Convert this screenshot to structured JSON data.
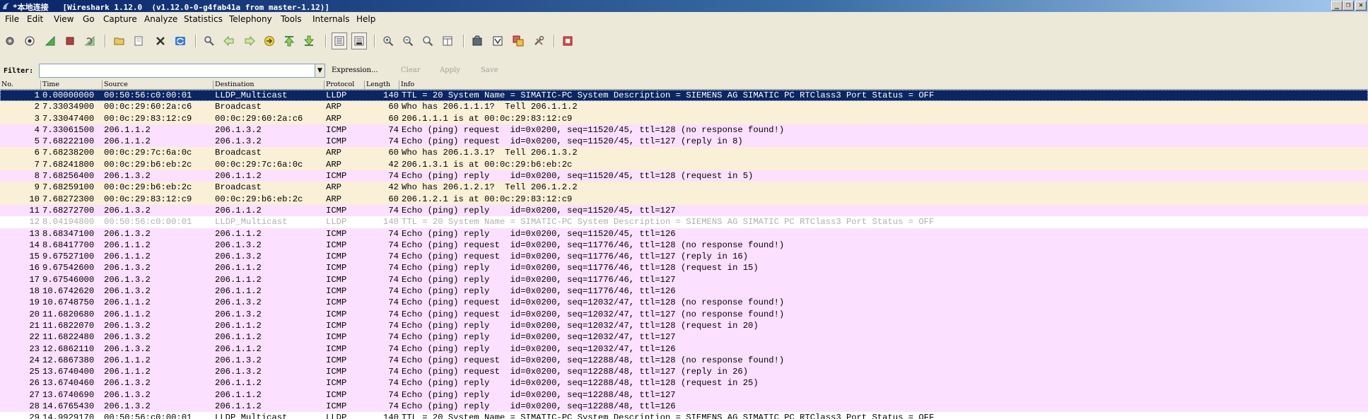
{
  "window": {
    "title": "*本地连接   [Wireshark 1.12.0  (v1.12.0-0-g4fab41a from master-1.12)]",
    "buttons": [
      "minimize",
      "restore",
      "close"
    ]
  },
  "menu": [
    "File",
    "Edit",
    "View",
    "Go",
    "Capture",
    "Analyze",
    "Statistics",
    "Telephony",
    "Tools",
    "Internals",
    "Help"
  ],
  "toolbar": {
    "icons": [
      "interfaces-icon",
      "options-icon",
      "start-capture-icon",
      "stop-capture-icon",
      "restart-capture-icon",
      "open-file-icon",
      "save-file-icon",
      "close-file-icon",
      "reload-icon",
      "find-packet-icon",
      "go-back-icon",
      "go-forward-icon",
      "go-to-packet-icon",
      "go-first-icon",
      "go-last-icon",
      "colorize-icon",
      "auto-scroll-icon",
      "zoom-in-icon",
      "zoom-out-icon",
      "zoom-normal-icon",
      "resize-columns-icon",
      "capture-filters-icon",
      "display-filters-icon",
      "coloring-rules-icon",
      "preferences-icon",
      "help-icon"
    ]
  },
  "filter": {
    "label": "Filter:",
    "value": "",
    "expression": "Expression...",
    "clear": "Clear",
    "apply": "Apply",
    "save": "Save"
  },
  "columns": [
    "No.",
    "Time",
    "Source",
    "Destination",
    "Protocol",
    "Length",
    "Info"
  ],
  "colors": {
    "lldp": "#ffffff",
    "arp": "#faf0d7",
    "icmp": "#fce0ff",
    "selected_bg": "#0a2665",
    "dim_text": "#b0b0b0",
    "menu_bg": "#ece9d8"
  },
  "packets": [
    {
      "no": "1",
      "time": "0.00000000",
      "src": "00:50:56:c0:00:01",
      "dst": "LLDP_Multicast",
      "proto": "LLDP",
      "len": "140",
      "info": "TTL = 20 System Name = SIMATIC-PC System Description = SIEMENS AG SIMATIC PC RTClass3 Port Status = OFF",
      "cls": "lldp",
      "selected": true
    },
    {
      "no": "2",
      "time": "7.33034900",
      "src": "00:0c:29:60:2a:c6",
      "dst": "Broadcast",
      "proto": "ARP",
      "len": "60",
      "info": "Who has 206.1.1.1?  Tell 206.1.1.2",
      "cls": "arp"
    },
    {
      "no": "3",
      "time": "7.33047400",
      "src": "00:0c:29:83:12:c9",
      "dst": "00:0c:29:60:2a:c6",
      "proto": "ARP",
      "len": "60",
      "info": "206.1.1.1 is at 00:0c:29:83:12:c9",
      "cls": "arp"
    },
    {
      "no": "4",
      "time": "7.33061500",
      "src": "206.1.1.2",
      "dst": "206.1.3.2",
      "proto": "ICMP",
      "len": "74",
      "info": "Echo (ping) request  id=0x0200, seq=11520/45, ttl=128 (no response found!)",
      "cls": "icmp"
    },
    {
      "no": "5",
      "time": "7.68222100",
      "src": "206.1.1.2",
      "dst": "206.1.3.2",
      "proto": "ICMP",
      "len": "74",
      "info": "Echo (ping) request  id=0x0200, seq=11520/45, ttl=127 (reply in 8)",
      "cls": "icmp"
    },
    {
      "no": "6",
      "time": "7.68238200",
      "src": "00:0c:29:7c:6a:0c",
      "dst": "Broadcast",
      "proto": "ARP",
      "len": "60",
      "info": "Who has 206.1.3.1?  Tell 206.1.3.2",
      "cls": "arp"
    },
    {
      "no": "7",
      "time": "7.68241800",
      "src": "00:0c:29:b6:eb:2c",
      "dst": "00:0c:29:7c:6a:0c",
      "proto": "ARP",
      "len": "42",
      "info": "206.1.3.1 is at 00:0c:29:b6:eb:2c",
      "cls": "arp"
    },
    {
      "no": "8",
      "time": "7.68256400",
      "src": "206.1.3.2",
      "dst": "206.1.1.2",
      "proto": "ICMP",
      "len": "74",
      "info": "Echo (ping) reply    id=0x0200, seq=11520/45, ttl=128 (request in 5)",
      "cls": "icmp"
    },
    {
      "no": "9",
      "time": "7.68259100",
      "src": "00:0c:29:b6:eb:2c",
      "dst": "Broadcast",
      "proto": "ARP",
      "len": "42",
      "info": "Who has 206.1.2.1?  Tell 206.1.2.2",
      "cls": "arp"
    },
    {
      "no": "10",
      "time": "7.68272300",
      "src": "00:0c:29:83:12:c9",
      "dst": "00:0c:29:b6:eb:2c",
      "proto": "ARP",
      "len": "60",
      "info": "206.1.2.1 is at 00:0c:29:83:12:c9",
      "cls": "arp"
    },
    {
      "no": "11",
      "time": "7.68272700",
      "src": "206.1.3.2",
      "dst": "206.1.1.2",
      "proto": "ICMP",
      "len": "74",
      "info": "Echo (ping) reply    id=0x0200, seq=11520/45, ttl=127",
      "cls": "icmp"
    },
    {
      "no": "12",
      "time": "8.04194800",
      "src": "00:50:56:c0:00:01",
      "dst": "LLDP_Multicast",
      "proto": "LLDP",
      "len": "140",
      "info": "TTL = 20 System Name = SIMATIC-PC System Description = SIEMENS AG SIMATIC PC RTClass3 Port Status = OFF",
      "cls": "lldp",
      "dim": true
    },
    {
      "no": "13",
      "time": "8.68347100",
      "src": "206.1.3.2",
      "dst": "206.1.1.2",
      "proto": "ICMP",
      "len": "74",
      "info": "Echo (ping) reply    id=0x0200, seq=11520/45, ttl=126",
      "cls": "icmp"
    },
    {
      "no": "14",
      "time": "8.68417700",
      "src": "206.1.1.2",
      "dst": "206.1.3.2",
      "proto": "ICMP",
      "len": "74",
      "info": "Echo (ping) request  id=0x0200, seq=11776/46, ttl=128 (no response found!)",
      "cls": "icmp"
    },
    {
      "no": "15",
      "time": "9.67527100",
      "src": "206.1.1.2",
      "dst": "206.1.3.2",
      "proto": "ICMP",
      "len": "74",
      "info": "Echo (ping) request  id=0x0200, seq=11776/46, ttl=127 (reply in 16)",
      "cls": "icmp"
    },
    {
      "no": "16",
      "time": "9.67542600",
      "src": "206.1.3.2",
      "dst": "206.1.1.2",
      "proto": "ICMP",
      "len": "74",
      "info": "Echo (ping) reply    id=0x0200, seq=11776/46, ttl=128 (request in 15)",
      "cls": "icmp"
    },
    {
      "no": "17",
      "time": "9.67546000",
      "src": "206.1.3.2",
      "dst": "206.1.1.2",
      "proto": "ICMP",
      "len": "74",
      "info": "Echo (ping) reply    id=0x0200, seq=11776/46, ttl=127",
      "cls": "icmp"
    },
    {
      "no": "18",
      "time": "10.6742620",
      "src": "206.1.3.2",
      "dst": "206.1.1.2",
      "proto": "ICMP",
      "len": "74",
      "info": "Echo (ping) reply    id=0x0200, seq=11776/46, ttl=126",
      "cls": "icmp"
    },
    {
      "no": "19",
      "time": "10.6748750",
      "src": "206.1.1.2",
      "dst": "206.1.3.2",
      "proto": "ICMP",
      "len": "74",
      "info": "Echo (ping) request  id=0x0200, seq=12032/47, ttl=128 (no response found!)",
      "cls": "icmp"
    },
    {
      "no": "20",
      "time": "11.6820680",
      "src": "206.1.1.2",
      "dst": "206.1.3.2",
      "proto": "ICMP",
      "len": "74",
      "info": "Echo (ping) request  id=0x0200, seq=12032/47, ttl=127 (no response found!)",
      "cls": "icmp"
    },
    {
      "no": "21",
      "time": "11.6822070",
      "src": "206.1.3.2",
      "dst": "206.1.1.2",
      "proto": "ICMP",
      "len": "74",
      "info": "Echo (ping) reply    id=0x0200, seq=12032/47, ttl=128 (request in 20)",
      "cls": "icmp"
    },
    {
      "no": "22",
      "time": "11.6822480",
      "src": "206.1.3.2",
      "dst": "206.1.1.2",
      "proto": "ICMP",
      "len": "74",
      "info": "Echo (ping) reply    id=0x0200, seq=12032/47, ttl=127",
      "cls": "icmp"
    },
    {
      "no": "23",
      "time": "12.6862110",
      "src": "206.1.3.2",
      "dst": "206.1.1.2",
      "proto": "ICMP",
      "len": "74",
      "info": "Echo (ping) reply    id=0x0200, seq=12032/47, ttl=126",
      "cls": "icmp"
    },
    {
      "no": "24",
      "time": "12.6867380",
      "src": "206.1.1.2",
      "dst": "206.1.3.2",
      "proto": "ICMP",
      "len": "74",
      "info": "Echo (ping) request  id=0x0200, seq=12288/48, ttl=128 (no response found!)",
      "cls": "icmp"
    },
    {
      "no": "25",
      "time": "13.6740400",
      "src": "206.1.1.2",
      "dst": "206.1.3.2",
      "proto": "ICMP",
      "len": "74",
      "info": "Echo (ping) request  id=0x0200, seq=12288/48, ttl=127 (reply in 26)",
      "cls": "icmp"
    },
    {
      "no": "26",
      "time": "13.6740460",
      "src": "206.1.3.2",
      "dst": "206.1.1.2",
      "proto": "ICMP",
      "len": "74",
      "info": "Echo (ping) reply    id=0x0200, seq=12288/48, ttl=128 (request in 25)",
      "cls": "icmp"
    },
    {
      "no": "27",
      "time": "13.6740690",
      "src": "206.1.3.2",
      "dst": "206.1.1.2",
      "proto": "ICMP",
      "len": "74",
      "info": "Echo (ping) reply    id=0x0200, seq=12288/48, ttl=127",
      "cls": "icmp"
    },
    {
      "no": "28",
      "time": "14.6765430",
      "src": "206.1.3.2",
      "dst": "206.1.1.2",
      "proto": "ICMP",
      "len": "74",
      "info": "Echo (ping) reply    id=0x0200, seq=12288/48, ttl=126",
      "cls": "icmp"
    },
    {
      "no": "29",
      "time": "14.9929170",
      "src": "00:50:56:c0:00:01",
      "dst": "LLDP_Multicast",
      "proto": "LLDP",
      "len": "140",
      "info": "TTL = 20 System Name = SIMATIC-PC System Description = SIEMENS AG SIMATIC PC RTClass3 Port Status = OFF",
      "cls": "lldp",
      "partial": true
    }
  ]
}
